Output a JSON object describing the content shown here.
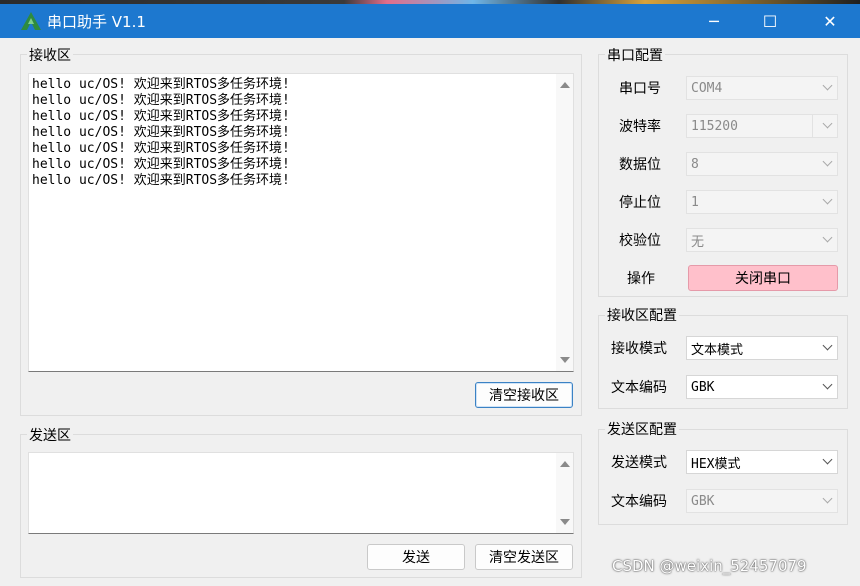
{
  "window": {
    "title": "串口助手 V1.1",
    "icon": "app-logo-icon",
    "controls": {
      "minimize": "─",
      "maximize": "☐",
      "close": "✕"
    }
  },
  "receive": {
    "group_title": "接收区",
    "text": "hello uc/OS! 欢迎来到RTOS多任务环境!\nhello uc/OS! 欢迎来到RTOS多任务环境!\nhello uc/OS! 欢迎来到RTOS多任务环境!\nhello uc/OS! 欢迎来到RTOS多任务环境!\nhello uc/OS! 欢迎来到RTOS多任务环境!\nhello uc/OS! 欢迎来到RTOS多任务环境!\nhello uc/OS! 欢迎来到RTOS多任务环境!",
    "clear_button": "清空接收区"
  },
  "send": {
    "group_title": "发送区",
    "text": "",
    "send_button": "发送",
    "clear_button": "清空发送区"
  },
  "serial_config": {
    "group_title": "串口配置",
    "port_label": "串口号",
    "port_value": "COM4",
    "baud_label": "波特率",
    "baud_value": "115200",
    "databits_label": "数据位",
    "databits_value": "8",
    "stopbits_label": "停止位",
    "stopbits_value": "1",
    "parity_label": "校验位",
    "parity_value": "无",
    "operation_label": "操作",
    "operation_button": "关闭串口"
  },
  "receive_config": {
    "group_title": "接收区配置",
    "mode_label": "接收模式",
    "mode_value": "文本模式",
    "encoding_label": "文本编码",
    "encoding_value": "GBK"
  },
  "send_config": {
    "group_title": "发送区配置",
    "mode_label": "发送模式",
    "mode_value": "HEX模式",
    "encoding_label": "文本编码",
    "encoding_value": "GBK"
  },
  "watermark": "CSDN @weixin_52457079",
  "colors": {
    "titlebar": "#1d78cf",
    "close_serial_button": "#ffc0cb"
  }
}
